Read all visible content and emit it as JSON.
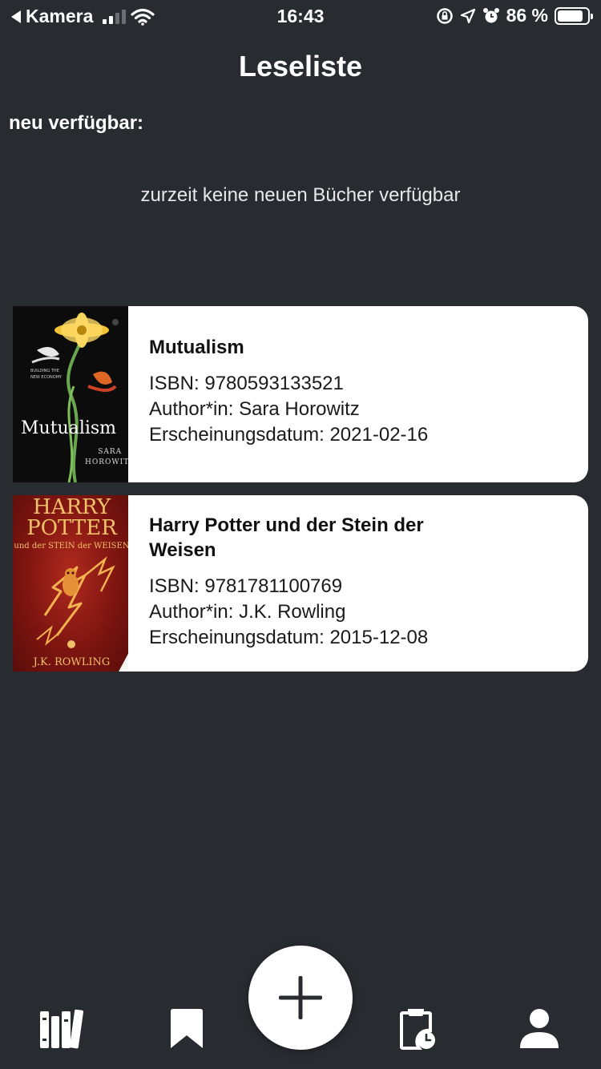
{
  "status_bar": {
    "back_app": "Kamera",
    "time": "16:43",
    "battery_percent": "86 %",
    "battery_level": 0.86
  },
  "page": {
    "title": "Leseliste",
    "new_section_label": "neu verfügbar:",
    "empty_message": "zurzeit keine neuen Bücher verfügbar"
  },
  "books": [
    {
      "title": "Mutualism",
      "isbn": "ISBN: 9780593133521",
      "author": "Author*in: Sara Horowitz",
      "release": "Erscheinungsdatum: 2021-02-16",
      "cover_title": "Mutualism",
      "cover_author": "SARA HOROWITZ"
    },
    {
      "title": "Harry Potter und der Stein der Weisen",
      "isbn": "ISBN: 9781781100769",
      "author": "Author*in: J.K. Rowling",
      "release": "Erscheinungsdatum: 2015-12-08",
      "cover_title": "HARRY POTTER",
      "cover_subtitle": "und der STEIN der WEISEN",
      "cover_author": "J.K. ROWLING"
    }
  ],
  "tab_bar": {
    "items": [
      "library-icon",
      "bookmark-icon",
      "plus-icon",
      "clipboard-clock-icon",
      "user-icon"
    ]
  },
  "colors": {
    "background": "#282b30",
    "card": "#ffffff",
    "text": "#ffffff"
  }
}
